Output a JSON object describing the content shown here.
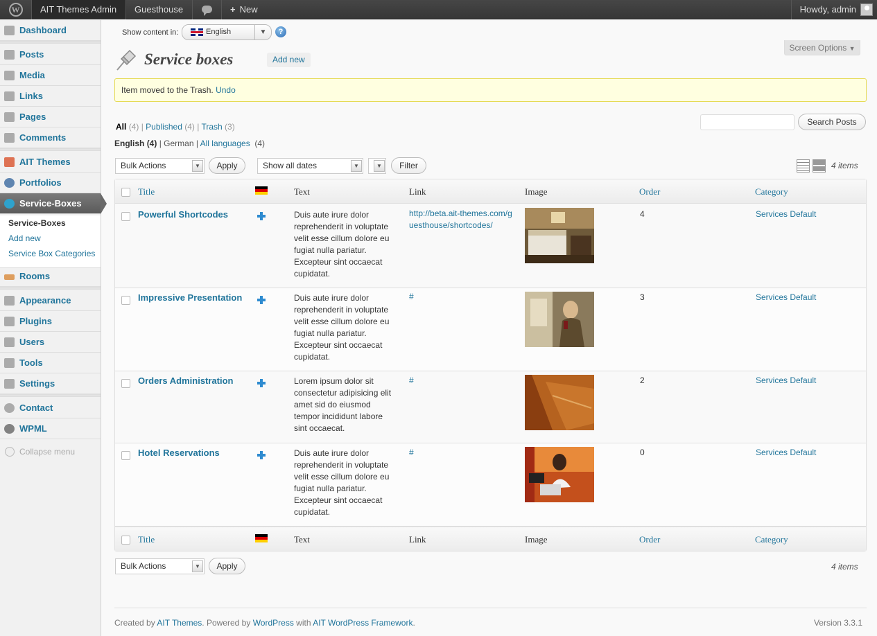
{
  "admin_bar": {
    "site": "AIT Themes Admin",
    "site2": "Guesthouse",
    "new_label": "New",
    "howdy": "Howdy, admin"
  },
  "sidebar": {
    "items": [
      {
        "label": "Dashboard",
        "icon": "dashboard-icon"
      },
      {
        "label": "Posts",
        "icon": "pin-icon"
      },
      {
        "label": "Media",
        "icon": "media-icon"
      },
      {
        "label": "Links",
        "icon": "link-icon"
      },
      {
        "label": "Pages",
        "icon": "pages-icon"
      },
      {
        "label": "Comments",
        "icon": "comments-icon"
      },
      {
        "label": "AIT Themes",
        "icon": "ait-icon"
      },
      {
        "label": "Portfolios",
        "icon": "portfolio-icon"
      },
      {
        "label": "Service-Boxes",
        "icon": "service-icon"
      },
      {
        "label": "Rooms",
        "icon": "bed-icon"
      },
      {
        "label": "Appearance",
        "icon": "appearance-icon"
      },
      {
        "label": "Plugins",
        "icon": "plugin-icon"
      },
      {
        "label": "Users",
        "icon": "users-icon"
      },
      {
        "label": "Tools",
        "icon": "tools-icon"
      },
      {
        "label": "Settings",
        "icon": "settings-icon"
      },
      {
        "label": "Contact",
        "icon": "gear-icon"
      },
      {
        "label": "WPML",
        "icon": "wpml-icon"
      }
    ],
    "submenu": [
      "Service-Boxes",
      "Add new",
      "Service Box Categories"
    ],
    "collapse": "Collapse menu"
  },
  "main": {
    "show_content_in": "Show content in:",
    "language": "English",
    "help": "?",
    "title": "Service boxes",
    "add_new": "Add new",
    "screen_options": "Screen Options",
    "notice_text": "Item moved to the Trash.",
    "notice_undo": "Undo",
    "views": [
      {
        "label": "All",
        "count": "(4)"
      },
      {
        "label": "Published",
        "count": "(4)"
      },
      {
        "label": "Trash",
        "count": "(3)"
      }
    ],
    "lang_views": {
      "english": "English",
      "english_count": "(4)",
      "german": "German",
      "all": "All languages",
      "all_count": "(4)"
    },
    "search_button": "Search Posts",
    "bulk_actions": "Bulk Actions",
    "apply": "Apply",
    "dates": "Show all dates",
    "filter": "Filter",
    "items_count": "4 items",
    "columns": {
      "title": "Title",
      "text": "Text",
      "link": "Link",
      "image": "Image",
      "order": "Order",
      "category": "Category"
    },
    "rows": [
      {
        "title": "Powerful Shortcodes",
        "text": "Duis aute irure dolor reprehenderit in voluptate velit esse cillum dolore eu fugiat nulla pariatur. Excepteur sint occaecat cupidatat.",
        "link": "http://beta.ait-themes.com/guesthouse/shortcodes/",
        "order": "4",
        "category": "Services Default"
      },
      {
        "title": "Impressive Presentation",
        "text": "Duis aute irure dolor reprehenderit in voluptate velit esse cillum dolore eu fugiat nulla pariatur. Excepteur sint occaecat cupidatat.",
        "link": "#",
        "order": "3",
        "category": "Services Default"
      },
      {
        "title": "Orders Administration",
        "text": "Lorem ipsum dolor sit consectetur adipisicing elit amet sid do eiusmod tempor incididunt labore sint occaecat.",
        "link": "#",
        "order": "2",
        "category": "Services Default"
      },
      {
        "title": "Hotel Reservations",
        "text": "Duis aute irure dolor reprehenderit in voluptate velit esse cillum dolore eu fugiat nulla pariatur. Excepteur sint occaecat cupidatat.",
        "link": "#",
        "order": "0",
        "category": "Services Default"
      }
    ]
  },
  "footer": {
    "created_by": "Created by",
    "ait": "AIT Themes",
    "powered_by": ". Powered by",
    "wordpress": "WordPress",
    "with": "with",
    "framework": "AIT WordPress Framework",
    "dot": ".",
    "version": "Version 3.3.1"
  }
}
